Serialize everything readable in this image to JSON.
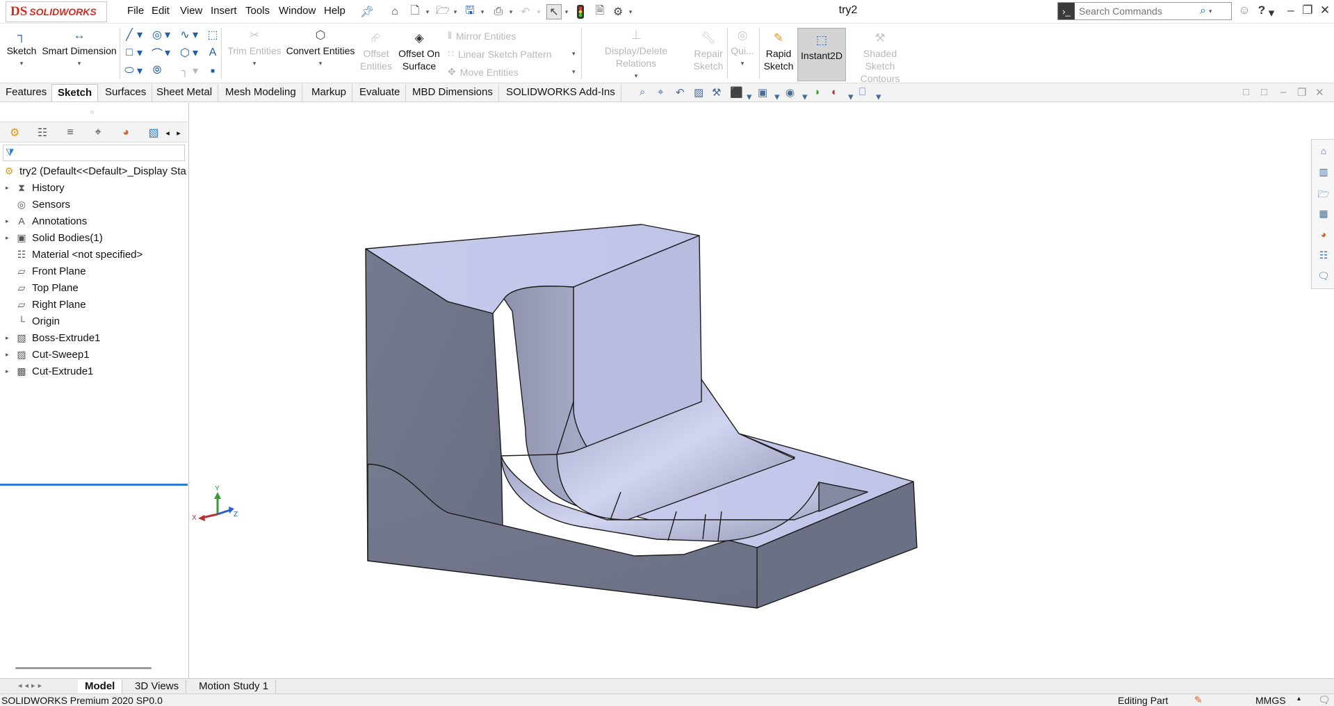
{
  "app": {
    "brand_ds": "DS",
    "brand_name": "SOLIDWORKS",
    "doc_title": "try2"
  },
  "menu": [
    "File",
    "Edit",
    "View",
    "Insert",
    "Tools",
    "Window",
    "Help"
  ],
  "search": {
    "placeholder": "Search Commands"
  },
  "ribbon": {
    "sketch": "Sketch",
    "smart_dimension": "Smart Dimension",
    "trim_entities": "Trim Entities",
    "convert_entities": "Convert Entities",
    "offset_entities_1": "Offset",
    "offset_entities_2": "Entities",
    "offset_on_surface_1": "Offset On",
    "offset_on_surface_2": "Surface",
    "mirror_entities": "Mirror Entities",
    "linear_sketch_pattern": "Linear Sketch Pattern",
    "move_entities": "Move Entities",
    "display_delete_relations": "Display/Delete Relations",
    "repair_sketch_1": "Repair",
    "repair_sketch_2": "Sketch",
    "quick_snaps": "Qui...",
    "rapid_sketch_1": "Rapid",
    "rapid_sketch_2": "Sketch",
    "instant2d": "Instant2D",
    "shaded_contours_1": "Shaded Sketch",
    "shaded_contours_2": "Contours"
  },
  "tabs": [
    "Features",
    "Sketch",
    "Surfaces",
    "Sheet Metal",
    "Mesh Modeling",
    "Markup",
    "Evaluate",
    "MBD Dimensions",
    "SOLIDWORKS Add-Ins"
  ],
  "active_tab": "Sketch",
  "tree": {
    "root": "try2  (Default<<Default>_Display Sta",
    "items": [
      {
        "label": "History",
        "expandable": true,
        "icon": "history-icon"
      },
      {
        "label": "Sensors",
        "expandable": false,
        "icon": "sensors-icon"
      },
      {
        "label": "Annotations",
        "expandable": true,
        "icon": "annotations-icon"
      },
      {
        "label": "Solid Bodies(1)",
        "expandable": true,
        "icon": "solid-bodies-icon"
      },
      {
        "label": "Material <not specified>",
        "expandable": false,
        "icon": "material-icon"
      },
      {
        "label": "Front Plane",
        "expandable": false,
        "icon": "plane-icon"
      },
      {
        "label": "Top Plane",
        "expandable": false,
        "icon": "plane-icon"
      },
      {
        "label": "Right Plane",
        "expandable": false,
        "icon": "plane-icon"
      },
      {
        "label": "Origin",
        "expandable": false,
        "icon": "origin-icon"
      },
      {
        "label": "Boss-Extrude1",
        "expandable": true,
        "icon": "boss-extrude-icon"
      },
      {
        "label": "Cut-Sweep1",
        "expandable": true,
        "icon": "cut-sweep-icon"
      },
      {
        "label": "Cut-Extrude1",
        "expandable": true,
        "icon": "cut-extrude-icon"
      }
    ]
  },
  "triad": {
    "x": "X",
    "y": "Y",
    "z": "Z"
  },
  "bottom_tabs": [
    "Model",
    "3D Views",
    "Motion Study 1"
  ],
  "status": {
    "left": "SOLIDWORKS Premium 2020 SP0.0",
    "mode": "Editing Part",
    "units": "MMGS"
  },
  "colors": {
    "brand": "#d52b1e",
    "accent": "#2b7bd4",
    "model_face_light": "#c9cdee",
    "model_face_dark": "#6f7387"
  }
}
